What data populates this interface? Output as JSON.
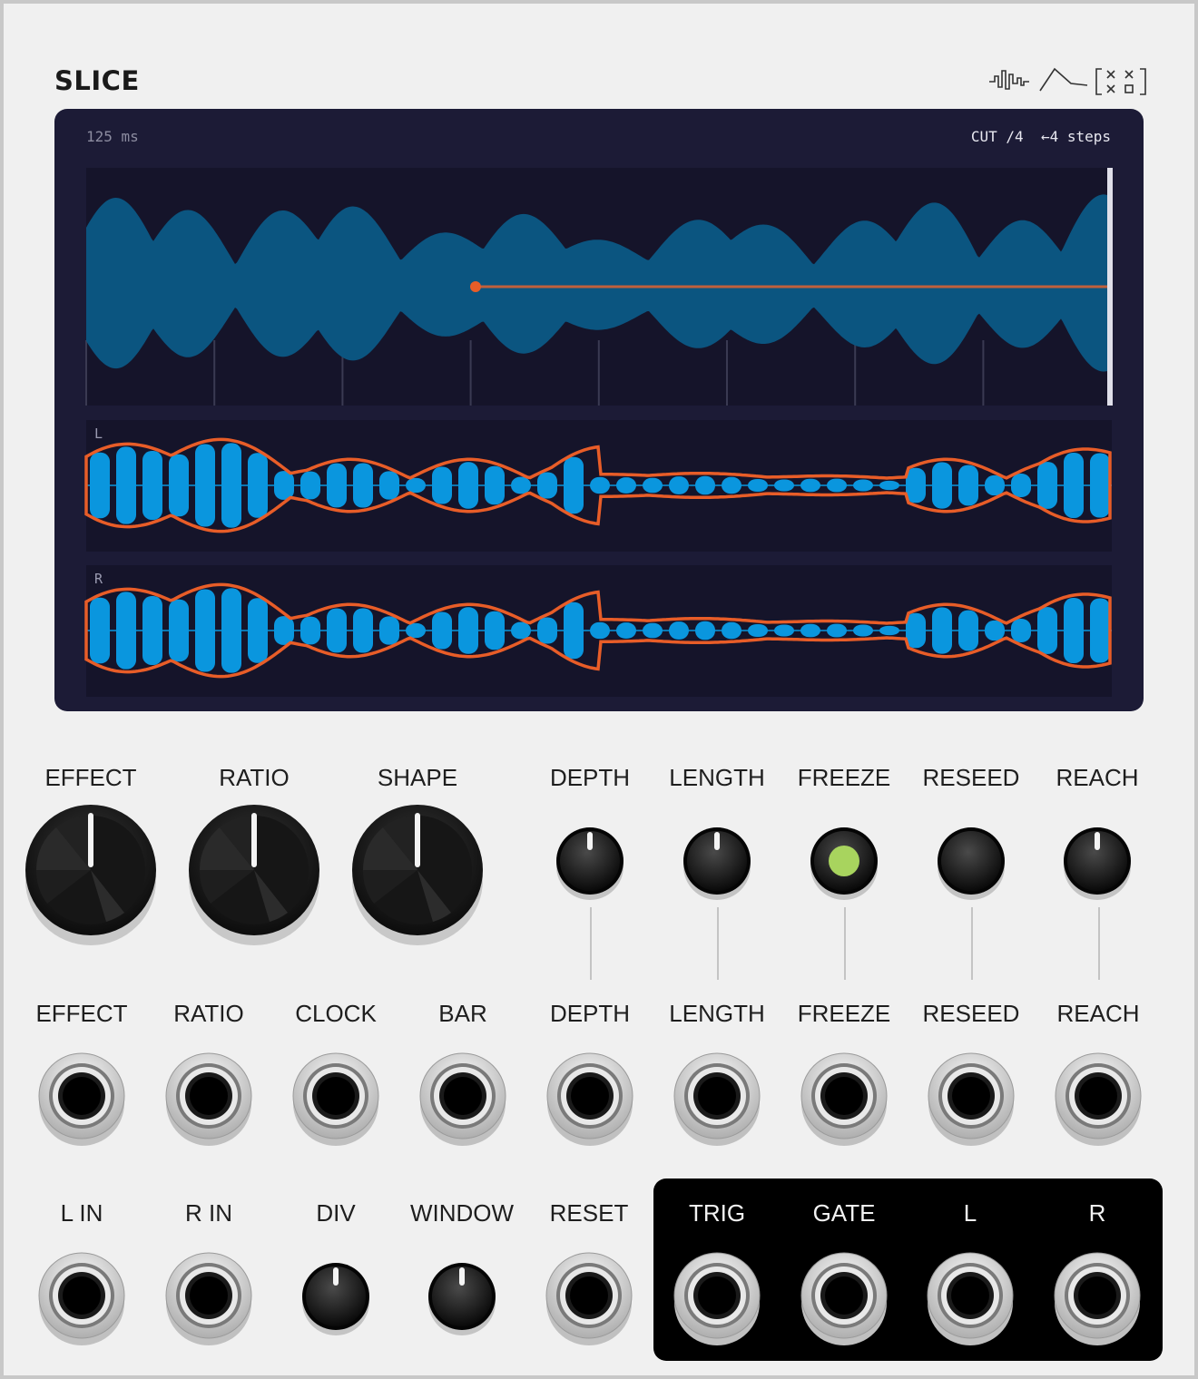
{
  "module": {
    "title": "SLICE"
  },
  "logo_icon": "waveform-envelope-grid-logo",
  "display": {
    "time_readout": "125 ms",
    "cut_readout": "CUT /4  ←4 steps",
    "channel_left": "L",
    "channel_right": "R"
  },
  "colors": {
    "panel": "#f0f0f0",
    "screen": "#1c1b36",
    "waveform": "#0b5580",
    "channel_fill": "#0a96de",
    "envelope": "#e85d28",
    "freeze_led": "#a8d45e",
    "output_panel": "#000000"
  },
  "knobs": {
    "large": [
      {
        "label": "EFFECT"
      },
      {
        "label": "RATIO"
      },
      {
        "label": "SHAPE"
      }
    ],
    "small": [
      {
        "label": "DEPTH",
        "kind": "knob"
      },
      {
        "label": "LENGTH",
        "kind": "knob"
      },
      {
        "label": "FREEZE",
        "kind": "button-lit"
      },
      {
        "label": "RESEED",
        "kind": "button"
      },
      {
        "label": "REACH",
        "kind": "knob"
      }
    ]
  },
  "cv_inputs": [
    "EFFECT",
    "RATIO",
    "CLOCK",
    "BAR",
    "DEPTH",
    "LENGTH",
    "FREEZE",
    "RESEED",
    "REACH"
  ],
  "bottom_row": {
    "inputs": [
      {
        "label": "L IN",
        "kind": "jack"
      },
      {
        "label": "R IN",
        "kind": "jack"
      },
      {
        "label": "DIV",
        "kind": "knob"
      },
      {
        "label": "WINDOW",
        "kind": "knob"
      },
      {
        "label": "RESET",
        "kind": "jack"
      }
    ],
    "outputs": [
      "TRIG",
      "GATE",
      "L",
      "R"
    ]
  }
}
